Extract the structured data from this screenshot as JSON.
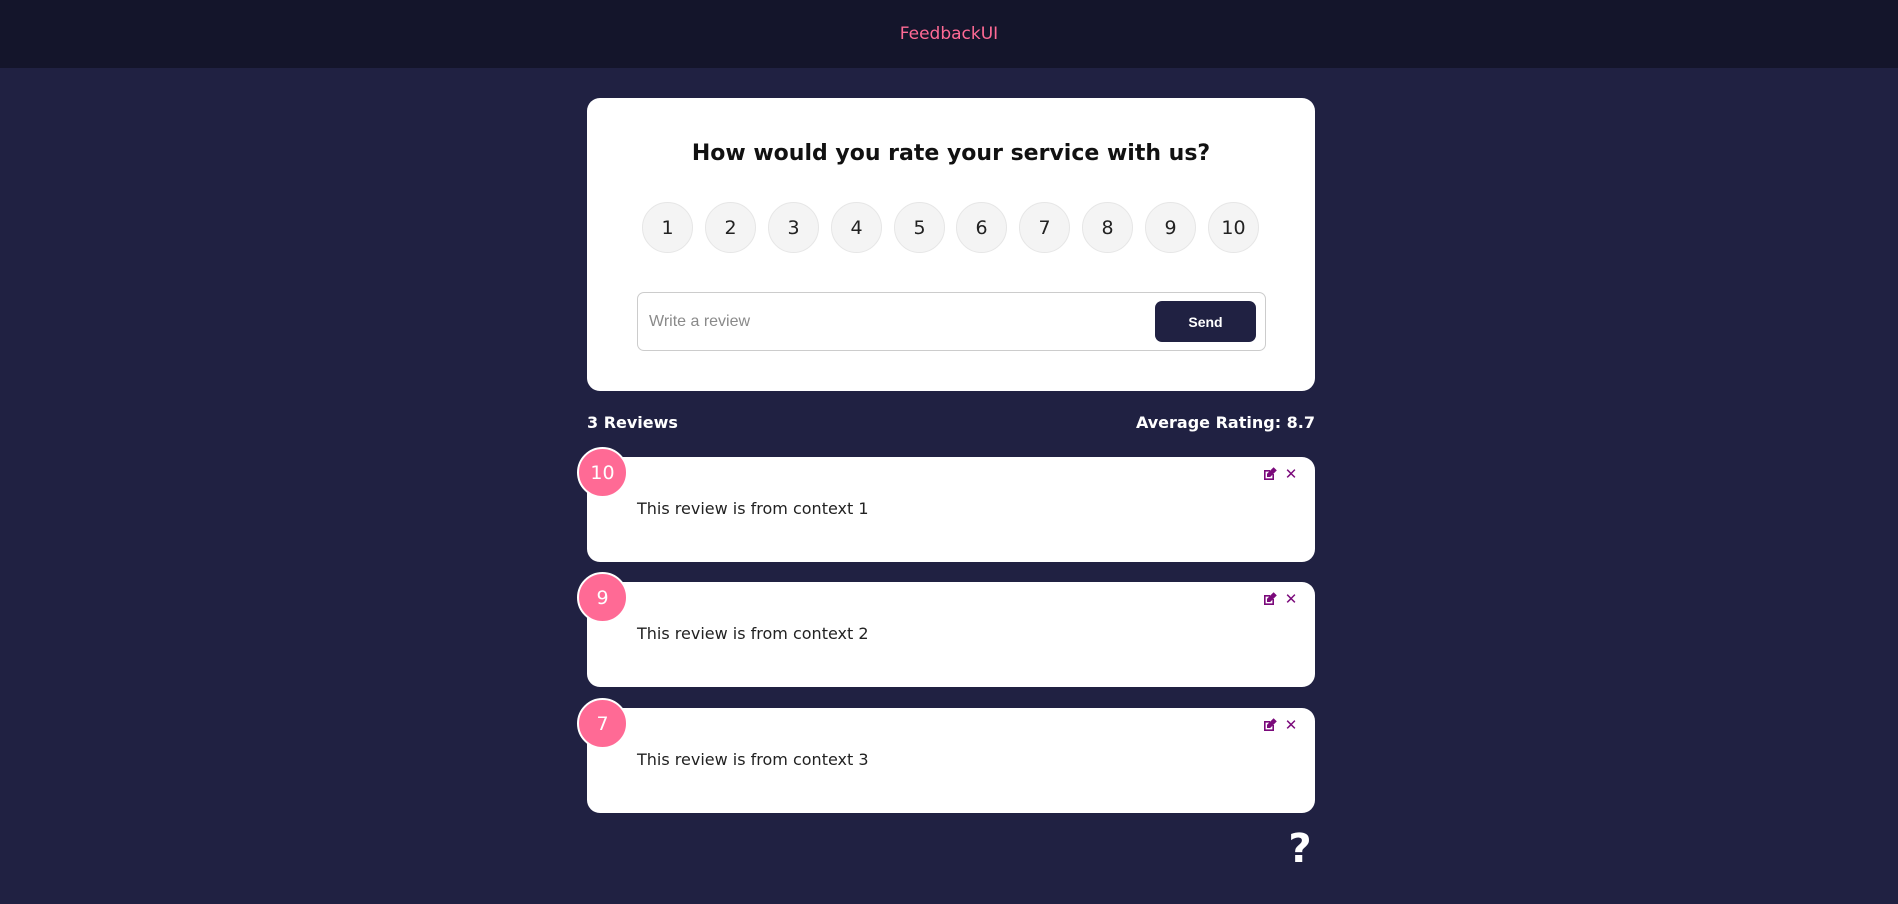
{
  "header": {
    "title": "FeedbackUI"
  },
  "rating": {
    "question": "How would you rate your service with us?",
    "options": [
      "1",
      "2",
      "3",
      "4",
      "5",
      "6",
      "7",
      "8",
      "9",
      "10"
    ]
  },
  "review_form": {
    "placeholder": "Write a review",
    "value": "",
    "send_label": "Send"
  },
  "stats": {
    "count_label": "3 Reviews",
    "average_label": "Average Rating: 8.7"
  },
  "reviews": [
    {
      "rating": "10",
      "text": "This review is from context 1",
      "edit_icon": "edit-icon",
      "delete_icon": "close-icon"
    },
    {
      "rating": "9",
      "text": "This review is from context 2",
      "edit_icon": "edit-icon",
      "delete_icon": "close-icon"
    },
    {
      "rating": "7",
      "text": "This review is from context 3",
      "edit_icon": "edit-icon",
      "delete_icon": "close-icon"
    }
  ],
  "help": {
    "icon": "question-mark-icon",
    "symbol": "?"
  },
  "colors": {
    "background": "#202142",
    "header": "#14152b",
    "accent": "#ff6a95",
    "icon": "#7b0a7b"
  }
}
